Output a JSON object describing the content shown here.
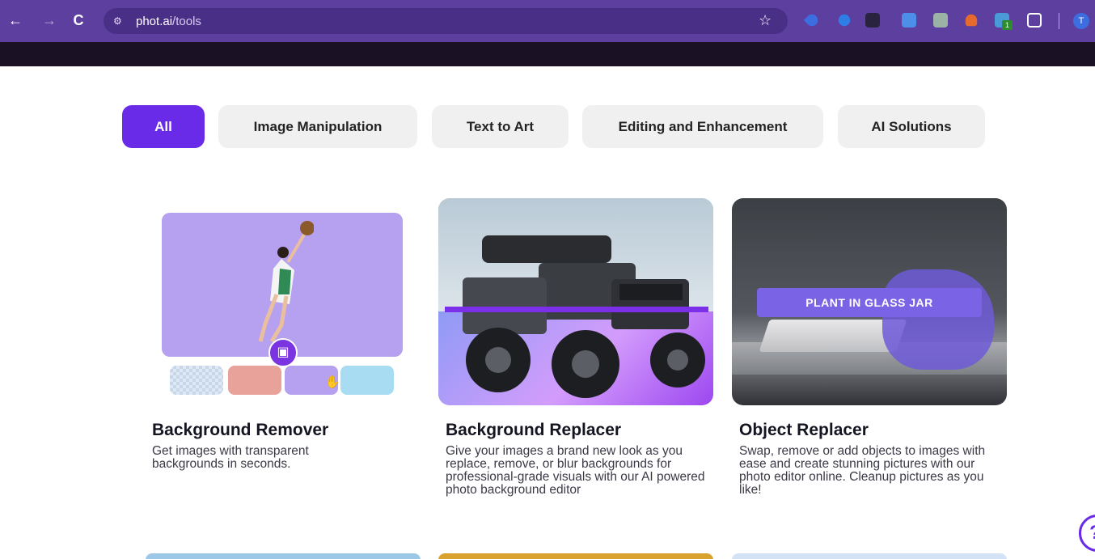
{
  "browser": {
    "url_host": "phot.ai",
    "url_path": "/tools",
    "back_icon": "←",
    "forward_icon": "→",
    "reload_icon": "C",
    "site_info_icon": "⚙",
    "star_icon": "☆",
    "extension_badge": "1",
    "profile_initial": "T"
  },
  "tabs": [
    {
      "label": "All",
      "active": true
    },
    {
      "label": "Image Manipulation",
      "active": false
    },
    {
      "label": "Text to Art",
      "active": false
    },
    {
      "label": "Editing and Enhancement",
      "active": false
    },
    {
      "label": "AI Solutions",
      "active": false
    }
  ],
  "cards": [
    {
      "title": "Background Remover",
      "description": "Get images with transparent backgrounds in seconds."
    },
    {
      "title": "Background Replacer",
      "description": "Give your images a brand new look as you replace, remove, or blur backgrounds for professional-grade visuals with our AI powered photo background editor"
    },
    {
      "title": "Object Replacer",
      "description": "Swap, remove or add objects to images with ease and create stunning pictures with our photo editor online. Cleanup pictures as you like!",
      "overlay_label": "PLANT IN  GLASS JAR"
    }
  ],
  "help_label": "?",
  "colors": {
    "brand_purple": "#6a2be8",
    "browser_bar": "#5c3f9e",
    "site_header": "#1a1124"
  }
}
